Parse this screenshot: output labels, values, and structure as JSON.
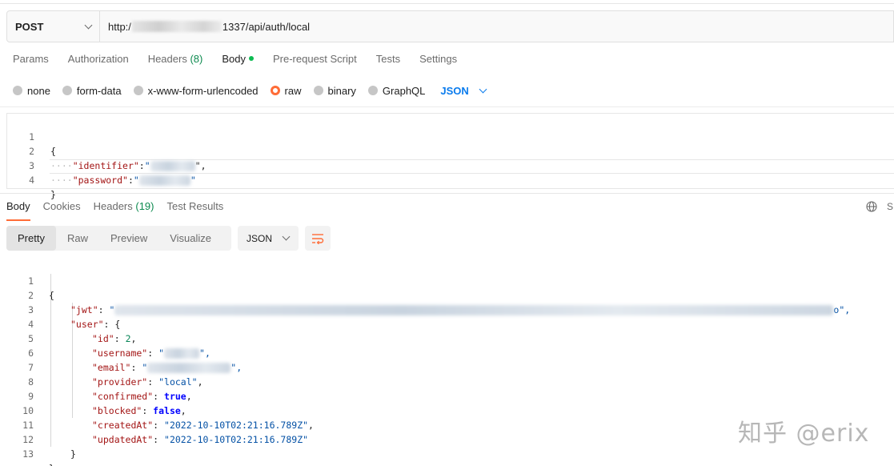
{
  "request": {
    "method": "POST",
    "url_prefix": "http:/",
    "url_suffix": "1337/api/auth/local"
  },
  "request_tabs": [
    {
      "label": "Params"
    },
    {
      "label": "Authorization"
    },
    {
      "label": "Headers",
      "count": "(8)"
    },
    {
      "label": "Body"
    },
    {
      "label": "Pre-request Script"
    },
    {
      "label": "Tests"
    },
    {
      "label": "Settings"
    }
  ],
  "body_types": [
    "none",
    "form-data",
    "x-www-form-urlencoded",
    "raw",
    "binary",
    "GraphQL"
  ],
  "body_language": "JSON",
  "request_body": {
    "lines": [
      {
        "n": "1",
        "text": "{"
      },
      {
        "n": "2",
        "key": "\"identifier\"",
        "val_open": "\"",
        "val_close": "\","
      },
      {
        "n": "3",
        "key": "\"password\"",
        "val_open": "\"",
        "val_close": "\""
      },
      {
        "n": "4",
        "text": "}"
      }
    ]
  },
  "response_tabs": [
    {
      "label": "Body"
    },
    {
      "label": "Cookies"
    },
    {
      "label": "Headers",
      "count": "(19)"
    },
    {
      "label": "Test Results"
    }
  ],
  "response_header_right": "S",
  "view_modes": [
    "Pretty",
    "Raw",
    "Preview",
    "Visualize"
  ],
  "response_format": "JSON",
  "response_body": {
    "l1": {
      "n": "1",
      "text": "{"
    },
    "l2": {
      "n": "2",
      "key": "\"jwt\"",
      "colon": ": ",
      "v_open": "\"",
      "v_close": "o\","
    },
    "l3": {
      "n": "3",
      "key": "\"user\"",
      "rest": ": {"
    },
    "l4": {
      "n": "4",
      "key": "\"id\"",
      "colon": ": ",
      "value": "2",
      "end": ","
    },
    "l5": {
      "n": "5",
      "key": "\"username\"",
      "colon": ": ",
      "v_open": "\"",
      "v_close": "\","
    },
    "l6": {
      "n": "6",
      "key": "\"email\"",
      "colon": ": ",
      "v_open": "\"",
      "v_close": "\","
    },
    "l7": {
      "n": "7",
      "key": "\"provider\"",
      "colon": ": ",
      "value": "\"local\"",
      "end": ","
    },
    "l8": {
      "n": "8",
      "key": "\"confirmed\"",
      "colon": ": ",
      "value": "true",
      "end": ","
    },
    "l9": {
      "n": "9",
      "key": "\"blocked\"",
      "colon": ": ",
      "value": "false",
      "end": ","
    },
    "l10": {
      "n": "10",
      "key": "\"createdAt\"",
      "colon": ": ",
      "value": "\"2022-10-10T02:21:16.789Z\"",
      "end": ","
    },
    "l11": {
      "n": "11",
      "key": "\"updatedAt\"",
      "colon": ": ",
      "value": "\"2022-10-10T02:21:16.789Z\"",
      "end": ""
    },
    "l12": {
      "n": "12",
      "text": "}"
    },
    "l13": {
      "n": "13",
      "text": "}"
    }
  },
  "watermark": "知乎 @erix",
  "colors": {
    "accent": "#ff6c37",
    "link": "#097bed",
    "active_dot": "#0cbb52"
  }
}
